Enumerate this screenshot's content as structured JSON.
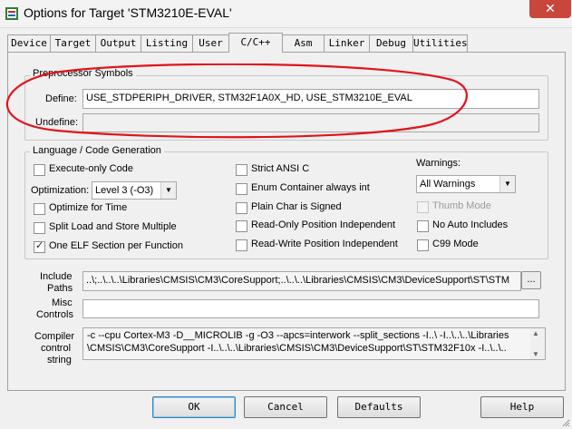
{
  "window": {
    "title": "Options for Target 'STM3210E-EVAL'",
    "close_glyph": "✕",
    "app_icon": "keil-uvision-icon"
  },
  "tabs": [
    {
      "label": "Device",
      "active": false
    },
    {
      "label": "Target",
      "active": false
    },
    {
      "label": "Output",
      "active": false
    },
    {
      "label": "Listing",
      "active": false
    },
    {
      "label": "User",
      "active": false
    },
    {
      "label": "C/C++",
      "active": true
    },
    {
      "label": "Asm",
      "active": false
    },
    {
      "label": "Linker",
      "active": false
    },
    {
      "label": "Debug",
      "active": false
    },
    {
      "label": "Utilities",
      "active": false
    }
  ],
  "preprocessor": {
    "group_title": "Preprocessor Symbols",
    "define_label": "Define:",
    "define_value": "USE_STDPERIPH_DRIVER, STM32F1A0X_HD, USE_STM3210E_EVAL",
    "undefine_label": "Undefine:",
    "undefine_value": ""
  },
  "language": {
    "group_title": "Language / Code Generation",
    "execute_only": {
      "label": "Execute-only Code",
      "checked": false
    },
    "optimization_label": "Optimization:",
    "optimization_value": "Level 3 (-O3)",
    "optimize_time": {
      "label": "Optimize for Time",
      "checked": false
    },
    "split_load": {
      "label": "Split Load and Store Multiple",
      "checked": false
    },
    "one_elf": {
      "label": "One ELF Section per Function",
      "checked": true
    },
    "strict_ansi": {
      "label": "Strict ANSI C",
      "checked": false
    },
    "enum_container": {
      "label": "Enum Container always int",
      "checked": false
    },
    "plain_char": {
      "label": "Plain Char is Signed",
      "checked": false
    },
    "ro_pos": {
      "label": "Read-Only Position Independent",
      "checked": false
    },
    "rw_pos": {
      "label": "Read-Write Position Independent",
      "checked": false
    },
    "warnings_label": "Warnings:",
    "warnings_value": "All Warnings",
    "thumb_mode": {
      "label": "Thumb Mode",
      "checked": false,
      "enabled": false
    },
    "no_auto_includes": {
      "label": "No Auto Includes",
      "checked": false
    },
    "c99_mode": {
      "label": "C99 Mode",
      "checked": false
    }
  },
  "include_paths": {
    "label_line1": "Include",
    "label_line2": "Paths",
    "value": "..\\;..\\..\\..\\Libraries\\CMSIS\\CM3\\CoreSupport;..\\..\\..\\Libraries\\CMSIS\\CM3\\DeviceSupport\\ST\\STM",
    "browse_label": "..."
  },
  "misc_controls": {
    "label_line1": "Misc",
    "label_line2": "Controls",
    "value": ""
  },
  "compiler_string": {
    "label_line1": "Compiler",
    "label_line2": "control",
    "label_line3": "string",
    "line1": "-c --cpu Cortex-M3 -D__MICROLIB -g -O3 --apcs=interwork --split_sections -I..\\ -I..\\..\\..\\Libraries",
    "line2": "\\CMSIS\\CM3\\CoreSupport -I..\\..\\..\\Libraries\\CMSIS\\CM3\\DeviceSupport\\ST\\STM32F10x -I..\\..\\.."
  },
  "buttons": {
    "ok": "OK",
    "cancel": "Cancel",
    "defaults": "Defaults",
    "help": "Help"
  },
  "colors": {
    "annotation_red": "#e0141b",
    "close_red": "#c9463d",
    "dialog_bg": "#f0f0f0"
  }
}
